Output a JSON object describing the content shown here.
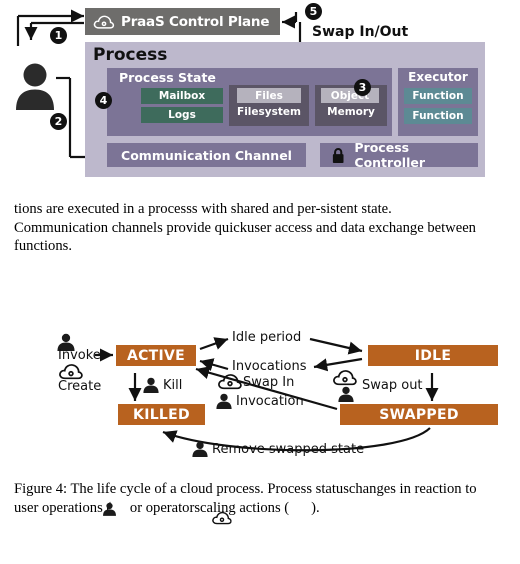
{
  "figure1": {
    "control_plane": {
      "label": "PraaS Control Plane",
      "icon": "cloud-icon",
      "bg": "#6e6d6b"
    },
    "process_panel": {
      "title": "Process",
      "bg": "#bdb8cc"
    },
    "process_state": {
      "title": "Process State",
      "bg": "#7c7496",
      "mailbox": "Mailbox",
      "logs": "Logs",
      "files": "Files",
      "filesystem": "Filesystem",
      "object": "Object",
      "memory": "Memory",
      "green": "#3e6b5c",
      "light_box": "#b5b2bd",
      "dark_box": "#5b5566"
    },
    "executor": {
      "title": "Executor",
      "function_1": "Function",
      "function_2": "Function",
      "teal": "#5d8a94"
    },
    "communication_channel": "Communication Channel",
    "process_controller": {
      "label": "Process Controller",
      "icon": "lock-icon"
    },
    "swap_label": "Swap In/Out",
    "badges": [
      {
        "number": "1"
      },
      {
        "number": "2"
      },
      {
        "number": "3"
      },
      {
        "number": "4"
      },
      {
        "number": "5"
      }
    ],
    "user_icon": "person-icon"
  },
  "paragraph": "tions are executed in a processs with shared and per-sistent state. Communication channels provide quickuser access and data exchange between functions.",
  "figure2": {
    "states": {
      "active": "ACTIVE",
      "idle": "IDLE",
      "killed": "KILLED",
      "swapped": "SWAPPED"
    },
    "state_color": "#b8621f",
    "labels": {
      "invoke": "Invoke",
      "create": "Create",
      "idle_period": "Idle period",
      "invocations": "Invocations",
      "kill": "Kill",
      "swap_in": "Swap In",
      "invocation": "Invocation",
      "swap_out": "Swap out",
      "remove_swapped_state": "Remove swapped state"
    }
  },
  "caption": {
    "part1": "Figure 4: The life cycle of a cloud process. Process statuschanges in reaction to user operations (",
    "part2": " or operatorscaling actions (",
    "part3": ")."
  }
}
